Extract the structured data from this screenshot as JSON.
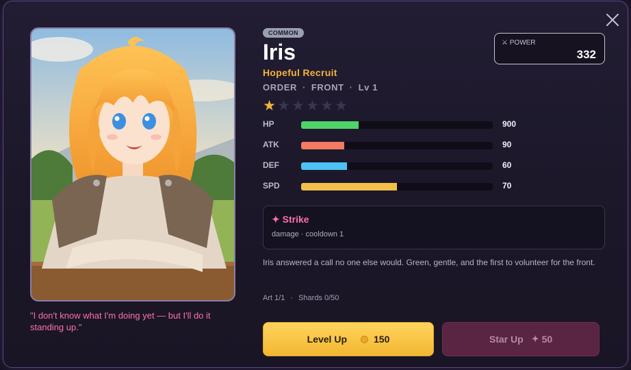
{
  "hero": {
    "rarity": "COMMON",
    "name": "Iris",
    "title": "Hopeful Recruit",
    "faction": "ORDER",
    "position": "FRONT",
    "level": "Lv 1",
    "stars_filled": 1,
    "stars_total": 6,
    "quote": "\"I don't know what I'm doing yet — but I'll do it standing up.\"",
    "bio": "Iris answered a call no one else would. Green, gentle, and the first to volunteer for the front."
  },
  "power": {
    "label": "⚔ POWER",
    "value": "332"
  },
  "stats": [
    {
      "label": "HP",
      "value": "900",
      "fill": 0.3,
      "color": "#4fd36a"
    },
    {
      "label": "ATK",
      "value": "90",
      "fill": 0.225,
      "color": "#f47a61"
    },
    {
      "label": "DEF",
      "value": "60",
      "fill": 0.24,
      "color": "#4cc2f5"
    },
    {
      "label": "SPD",
      "value": "70",
      "fill": 0.5,
      "color": "#f2c04a"
    }
  ],
  "skill": {
    "name": "✦ Strike",
    "desc": "damage · cooldown 1"
  },
  "collection": {
    "art": "Art 1/1",
    "shards": "Shards 0/50"
  },
  "buttons": {
    "level_up": {
      "label": "Level Up",
      "cost": "150"
    },
    "star_up": {
      "label": "Star Up",
      "cost": "50",
      "cost_icon": "✦"
    }
  },
  "icons": {
    "close": "close-icon",
    "coin": "coin-icon",
    "sword": "sword-icon",
    "star": "star-icon"
  }
}
